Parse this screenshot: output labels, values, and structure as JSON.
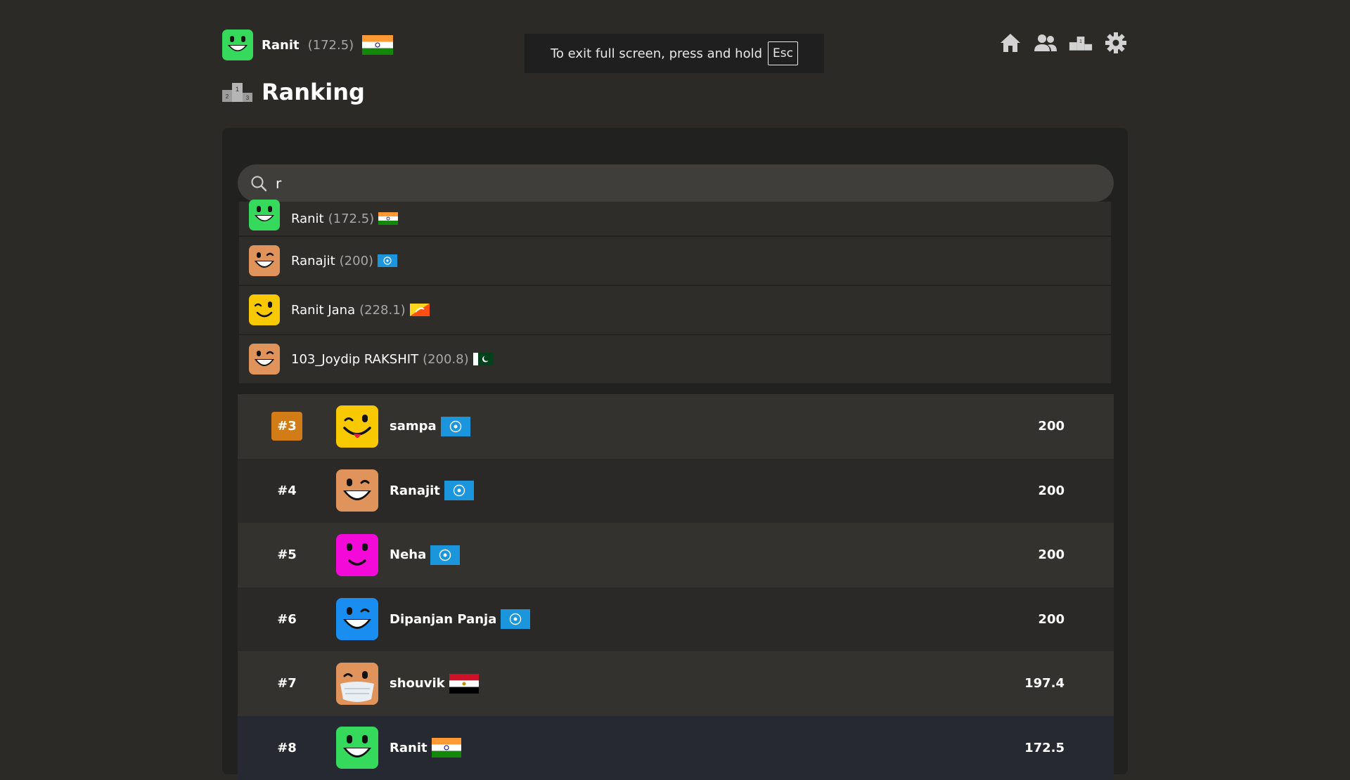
{
  "colors": {
    "accent_badge": "#d17c16",
    "green_avatar": "#35d95c",
    "orange_avatar": "#e0935a",
    "yellow_avatar": "#f8c800",
    "magenta_avatar": "#f40ad8",
    "blue_avatar": "#1a8df0"
  },
  "header": {
    "user_name": "Ranit",
    "user_rating": "(172.5)",
    "user_flag": "india-flag",
    "nav_icons": [
      "home-icon",
      "friends-icon",
      "podium-icon",
      "gear-icon"
    ]
  },
  "toast": {
    "text": "To exit full screen, press and hold",
    "key": "Esc"
  },
  "page": {
    "title": "Ranking",
    "title_icon": "podium-icon"
  },
  "search": {
    "value": "r",
    "icon": "search-icon"
  },
  "results": [
    {
      "name": "Ranit",
      "rating": "(172.5)",
      "flag": "india-flag",
      "avatar": "green-grin"
    },
    {
      "name": "Ranajit",
      "rating": "(200)",
      "flag": "un-flag",
      "avatar": "orange-wink"
    },
    {
      "name": "Ranit Jana",
      "rating": "(228.1)",
      "flag": "bhutan-flag",
      "avatar": "yellow-smile"
    },
    {
      "name": "103_Joydip RAKSHIT",
      "rating": "(200.8)",
      "flag": "pakistan-flag",
      "avatar": "orange-wink"
    }
  ],
  "ranking": [
    {
      "rank": "#3",
      "name": "sampa",
      "flag": "un-flag",
      "score": "200",
      "avatar": "yellow-tongue"
    },
    {
      "rank": "#4",
      "name": "Ranajit",
      "flag": "un-flag",
      "score": "200",
      "avatar": "orange-wink"
    },
    {
      "rank": "#5",
      "name": "Neha",
      "flag": "un-flag",
      "score": "200",
      "avatar": "magenta-smile"
    },
    {
      "rank": "#6",
      "name": "Dipanjan Panja",
      "flag": "un-flag",
      "score": "200",
      "avatar": "blue-wink"
    },
    {
      "rank": "#7",
      "name": "shouvik",
      "flag": "egypt-flag",
      "score": "197.4",
      "avatar": "orange-mask"
    },
    {
      "rank": "#8",
      "name": "Ranit",
      "flag": "india-flag",
      "score": "172.5",
      "avatar": "green-grin"
    }
  ]
}
